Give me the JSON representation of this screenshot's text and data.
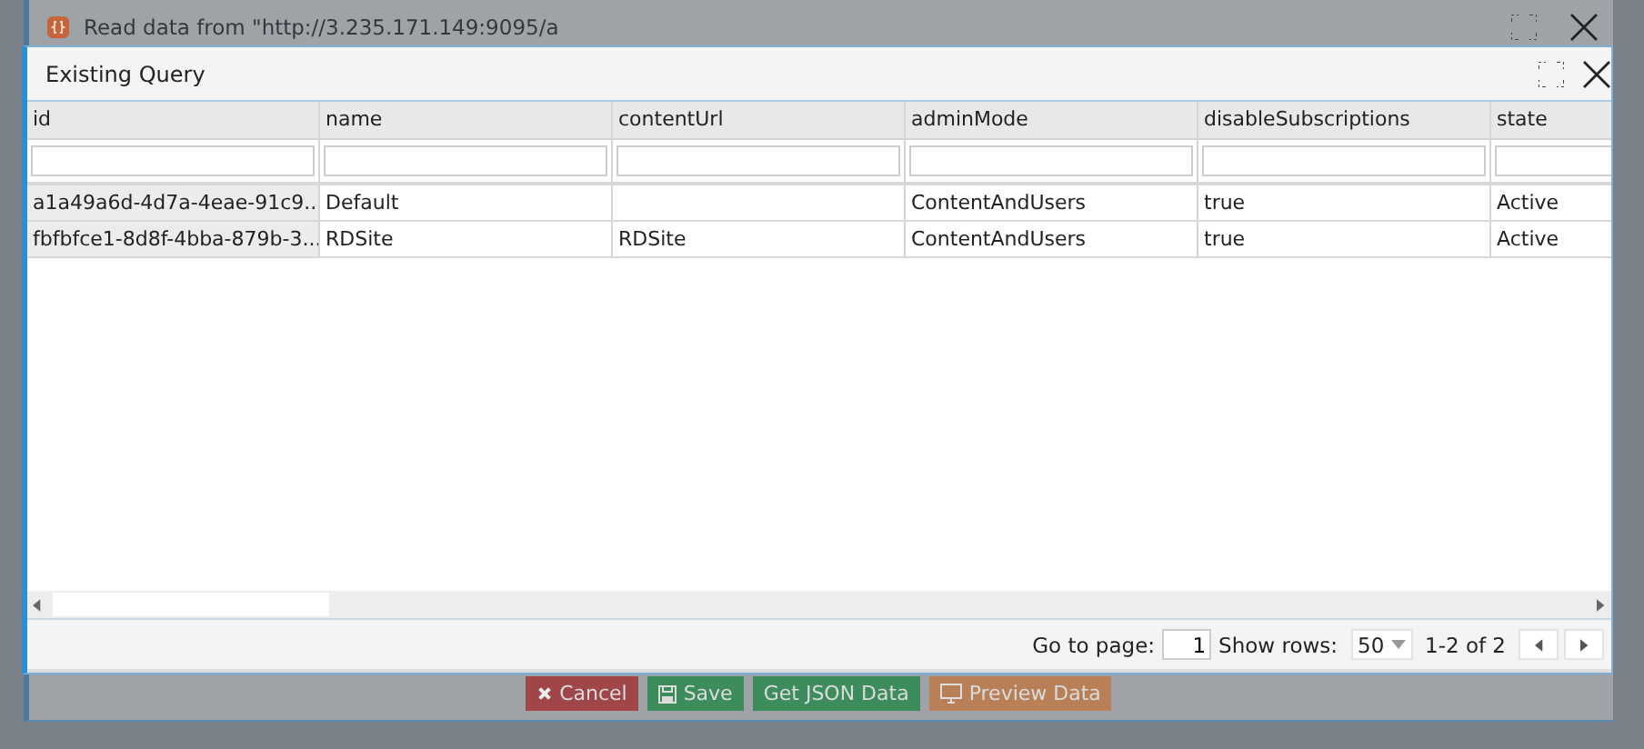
{
  "background_dialog": {
    "title": "Read data from \"http://3.235.171.149:9095/a",
    "buttons": [
      {
        "label": "Cancel",
        "kind": "cancel"
      },
      {
        "label": "Save",
        "kind": "save"
      },
      {
        "label": "Get JSON Data",
        "kind": "json"
      },
      {
        "label": "Preview Data",
        "kind": "preview"
      }
    ]
  },
  "dialog": {
    "title": "Existing Query",
    "table": {
      "columns": [
        "id",
        "name",
        "contentUrl",
        "adminMode",
        "disableSubscriptions",
        "state"
      ],
      "rows": [
        [
          "a1a49a6d-4d7a-4eae-91c9...",
          "Default",
          null,
          "ContentAndUsers",
          "true",
          "Active"
        ],
        [
          "fbfbfce1-8d8f-4bba-879b-3...",
          "RDSite",
          "RDSite",
          "ContentAndUsers",
          "true",
          "Active"
        ]
      ]
    },
    "pager": {
      "go_to_label": "Go to page:",
      "page": "1",
      "rows_label": "Show rows:",
      "rows_per_page": "50",
      "range": "1-2 of 2"
    }
  }
}
